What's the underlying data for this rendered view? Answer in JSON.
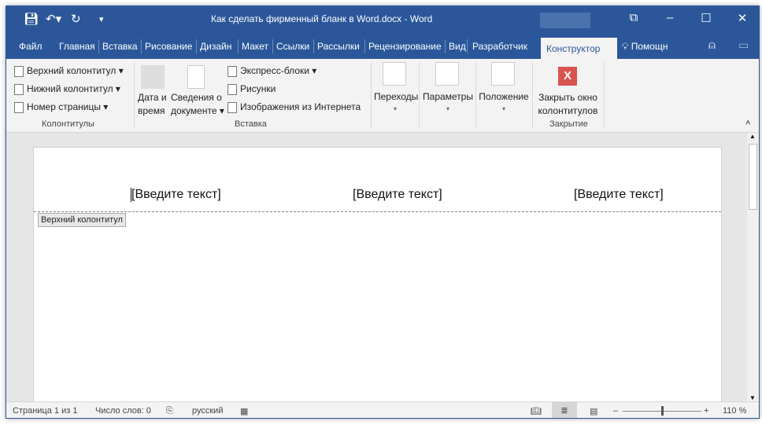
{
  "title": "Как сделать фирменный бланк в Word.docx  -  Word",
  "tabs": [
    "Файл",
    "Главная",
    "Вставка",
    "Рисование",
    "Дизайн",
    "Макет",
    "Ссылки",
    "Рассылки",
    "Рецензирование",
    "Вид",
    "Разработчик"
  ],
  "active_tab": "Конструктор",
  "help": "Помощн",
  "ribbon": {
    "header": "Верхний колонтитул",
    "footer": "Нижний колонтитул",
    "page_number": "Номер страницы",
    "group1": "Колонтитулы",
    "date1": "Дата и",
    "date2": "время",
    "docinfo1": "Сведения о",
    "docinfo2": "документе",
    "quick_parts": "Экспресс-блоки",
    "pictures": "Рисунки",
    "online_pictures": "Изображения из Интернета",
    "group2": "Вставка",
    "navigation": "Переходы",
    "options": "Параметры",
    "position": "Положение",
    "close1": "Закрыть окно",
    "close2": "колонтитулов",
    "group_close": "Закрытие"
  },
  "doc": {
    "placeholders": [
      "[Введите текст]",
      "[Введите текст]",
      "[Введите текст]"
    ],
    "header_label": "Верхний колонтитул"
  },
  "status": {
    "page": "Страница 1 из 1",
    "words": "Число слов: 0",
    "lang": "русский",
    "zoom": "110 %",
    "zoom_level": 110
  },
  "colors": {
    "brand": "#2b579a",
    "close": "#d9534f"
  }
}
